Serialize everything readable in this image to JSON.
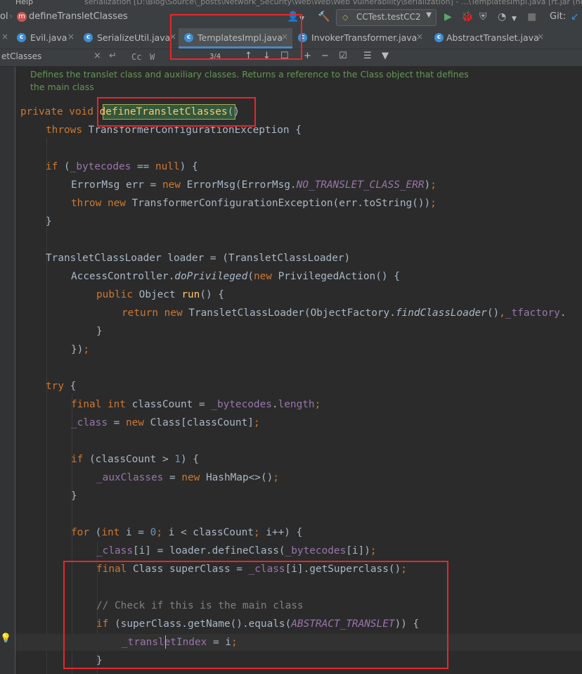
{
  "window": {
    "menu_fragment": "Help",
    "title_fragment": "serialization [D:\\Blog\\Source\\_posts\\Network_Security\\Web\\Web\\Web Vulnerability\\serialization] - ...\\TemplatesImpl.java [rt.jar (not latest)]"
  },
  "navbar": {
    "crumb_prev": "ol",
    "crumb_badge": "m",
    "crumb_current": "defineTransletClasses",
    "run_config_label": "CCTest.testCC2",
    "git_label": "Git:"
  },
  "tabs": [
    {
      "label": "Evil.java"
    },
    {
      "label": "SerializeUtil.java"
    },
    {
      "label": "TemplatesImpl.java",
      "active": true
    },
    {
      "label": "InvokerTransformer.java"
    },
    {
      "label": "AbstractTranslet.java"
    }
  ],
  "search": {
    "query": "etClasses",
    "match_count": "3/4",
    "case_label": "Cc",
    "word_label": "W"
  },
  "doc_comment": [
    "Defines the translet class and auxiliary classes. Returns a reference to the Class object that defines",
    "the main class"
  ],
  "code_lines": [
    "private void defineTransletClasses()",
    "throws TransformerConfigurationException {",
    "if (_bytecodes == null) {",
    "ErrorMsg err = new ErrorMsg(ErrorMsg.NO_TRANSLET_CLASS_ERR);",
    "throw new TransformerConfigurationException(err.toString());",
    "}",
    "TransletClassLoader loader = (TransletClassLoader)",
    "AccessController.doPrivileged(new PrivilegedAction() {",
    "public Object run() {",
    "return new TransletClassLoader(ObjectFactory.findClassLoader(),_tfactory.",
    "}",
    "});",
    "try {",
    "final int classCount = _bytecodes.length;",
    "_class = new Class[classCount];",
    "if (classCount > 1) {",
    "_auxClasses = new HashMap<>();",
    "}",
    "for (int i = 0; i < classCount; i++) {",
    "_class[i] = loader.defineClass(_bytecodes[i]);",
    "final Class superClass = _class[i].getSuperclass();",
    "// Check if this is the main class",
    "if (superClass.getName().equals(ABSTRACT_TRANSLET)) {",
    "_transletIndex = i;",
    "}"
  ],
  "colors": {
    "background": "#2b2b2b",
    "keyword": "#cc7832",
    "field": "#9876aa",
    "method": "#ffc66d",
    "number": "#6897bb",
    "comment": "#808080",
    "doc_comment": "#629755",
    "annotation_box": "#e8262c"
  }
}
